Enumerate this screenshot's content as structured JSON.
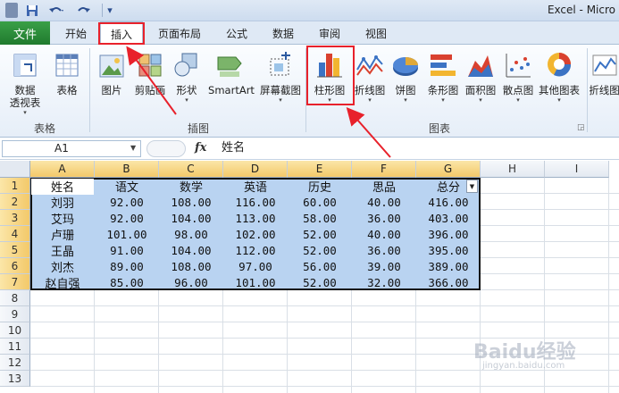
{
  "window": {
    "title": "Excel - Micro"
  },
  "quick_access": {
    "save_icon": "save-icon",
    "undo_icon": "undo-icon",
    "redo_icon": "redo-icon",
    "customize_icon": "customize-icon"
  },
  "tabs": {
    "file": "文件",
    "home": "开始",
    "insert": "插入",
    "page_layout": "页面布局",
    "formulas": "公式",
    "data": "数据",
    "review": "审阅",
    "view": "视图"
  },
  "ribbon": {
    "tables": {
      "pivot": "数据\n透视表",
      "table": "表格",
      "group": "表格"
    },
    "illustrations": {
      "picture": "图片",
      "clipart": "剪贴画",
      "shapes": "形状",
      "smartart": "SmartArt",
      "screenshot": "屏幕截图",
      "group": "插图"
    },
    "charts": {
      "column": "柱形图",
      "line": "折线图",
      "pie": "饼图",
      "bar": "条形图",
      "area": "面积图",
      "scatter": "散点图",
      "other": "其他图表",
      "group": "图表"
    },
    "sparklines": {
      "line": "折线图"
    }
  },
  "formula_bar": {
    "name_box": "A1",
    "fx": "fx",
    "formula": "姓名"
  },
  "columns": [
    "A",
    "B",
    "C",
    "D",
    "E",
    "F",
    "G",
    "H",
    "I"
  ],
  "rows": [
    "1",
    "2",
    "3",
    "4",
    "5",
    "6",
    "7",
    "8",
    "9",
    "10",
    "11",
    "12",
    "13"
  ],
  "sheet": {
    "headers": [
      "姓名",
      "语文",
      "数学",
      "英语",
      "历史",
      "思品",
      "总分"
    ],
    "data": [
      [
        "刘羽",
        "92.00",
        "108.00",
        "116.00",
        "60.00",
        "40.00",
        "416.00"
      ],
      [
        "艾玛",
        "92.00",
        "104.00",
        "113.00",
        "58.00",
        "36.00",
        "403.00"
      ],
      [
        "卢珊",
        "101.00",
        "98.00",
        "102.00",
        "52.00",
        "40.00",
        "396.00"
      ],
      [
        "王晶",
        "91.00",
        "104.00",
        "112.00",
        "52.00",
        "36.00",
        "395.00"
      ],
      [
        "刘杰",
        "89.00",
        "108.00",
        "97.00",
        "56.00",
        "39.00",
        "389.00"
      ],
      [
        "赵自强",
        "85.00",
        "96.00",
        "101.00",
        "52.00",
        "32.00",
        "366.00"
      ]
    ]
  },
  "watermark": {
    "text": "Baidu经验",
    "sub": "jingyan.baidu.com"
  },
  "colors": {
    "highlight": "#e8212b",
    "selection": "#b9d3f1",
    "file_tab": "#1f7a2e"
  }
}
